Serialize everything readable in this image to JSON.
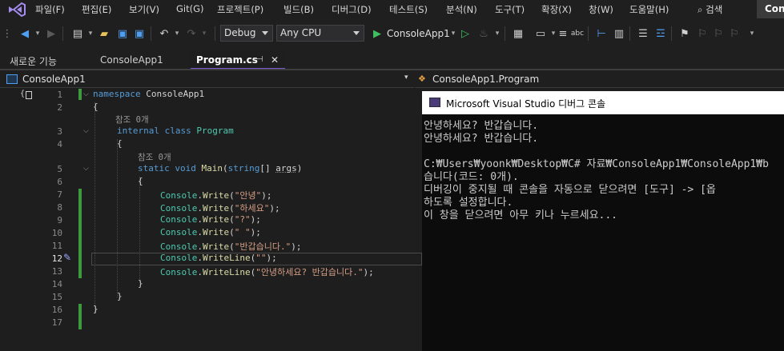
{
  "menu": {
    "items": [
      "파일(F)",
      "편집(E)",
      "보기(V)",
      "Git(G)",
      "프로젝트(P)",
      "빌드(B)",
      "디버그(D)",
      "테스트(S)",
      "분석(N)",
      "도구(T)",
      "확장(X)",
      "창(W)",
      "도움말(H)"
    ],
    "search_label": "검색",
    "title_chip": "Cons"
  },
  "toolbar": {
    "configuration": "Debug",
    "platform": "Any CPU",
    "run_target": "ConsoleApp1"
  },
  "tabs": [
    {
      "label": "새로운 기능"
    },
    {
      "label": "ConsoleApp1"
    },
    {
      "label": "Program.cs",
      "pin": "⊣",
      "close": "✕"
    }
  ],
  "nav": {
    "project": "ConsoleApp1",
    "member": "ConsoleApp1.Program"
  },
  "editor": {
    "line_numbers": [
      "1",
      "2",
      "3",
      "4",
      "5",
      "6",
      "7",
      "8",
      "9",
      "10",
      "11",
      "12",
      "13",
      "14",
      "15",
      "16",
      "17"
    ],
    "current_line": "12",
    "ref_label_1": "참조 0개",
    "ref_label_2": "참조 0개",
    "code": {
      "l1_kw": "namespace",
      "l1_name": " ConsoleApp1",
      "l2": "{",
      "l3_kw1": "internal",
      "l3_kw2": " class",
      "l3_name": " Program",
      "l4": "{",
      "l5_kw1": "static",
      "l5_kw2": " void",
      "l5_fn": " Main",
      "l5_p1": "(",
      "l5_kw3": "string",
      "l5_p2": "[] ",
      "l5_arg": "args",
      "l5_p3": ")",
      "l6": "{",
      "console": "Console",
      "write": "Write",
      "writeline": "WriteLine",
      "s7": "\"안녕\"",
      "s8": "\"하세요\"",
      "s9": "\"?\"",
      "s10": "\" \"",
      "s11": "\"반갑습니다.\"",
      "s12": "\"\"",
      "s13": "\"안녕하세요? 반갑습니다.\"",
      "l14": "}",
      "l15": "}",
      "l16": "}"
    }
  },
  "console": {
    "title": "Microsoft Visual Studio 디버그 콘솔",
    "lines": [
      "안녕하세요? 반갑습니다.",
      "안녕하세요? 반갑습니다.",
      "",
      "C:₩Users₩yoonk₩Desktop₩C# 자료₩ConsoleApp1₩ConsoleApp1₩b",
      "습니다(코드: 0개).",
      "디버깅이 중지될 때 콘솔을 자동으로 닫으려면 [도구] -> [옵",
      "하도록 설정합니다.",
      "이 창을 닫으려면 아무 키나 누르세요..."
    ]
  },
  "colors": {
    "accent": "#7d5bd3",
    "change_bar": "#3c9a3c",
    "keyword": "#569cd6",
    "type": "#4ec9b0",
    "method": "#dcdcaa",
    "string": "#d69d85"
  }
}
